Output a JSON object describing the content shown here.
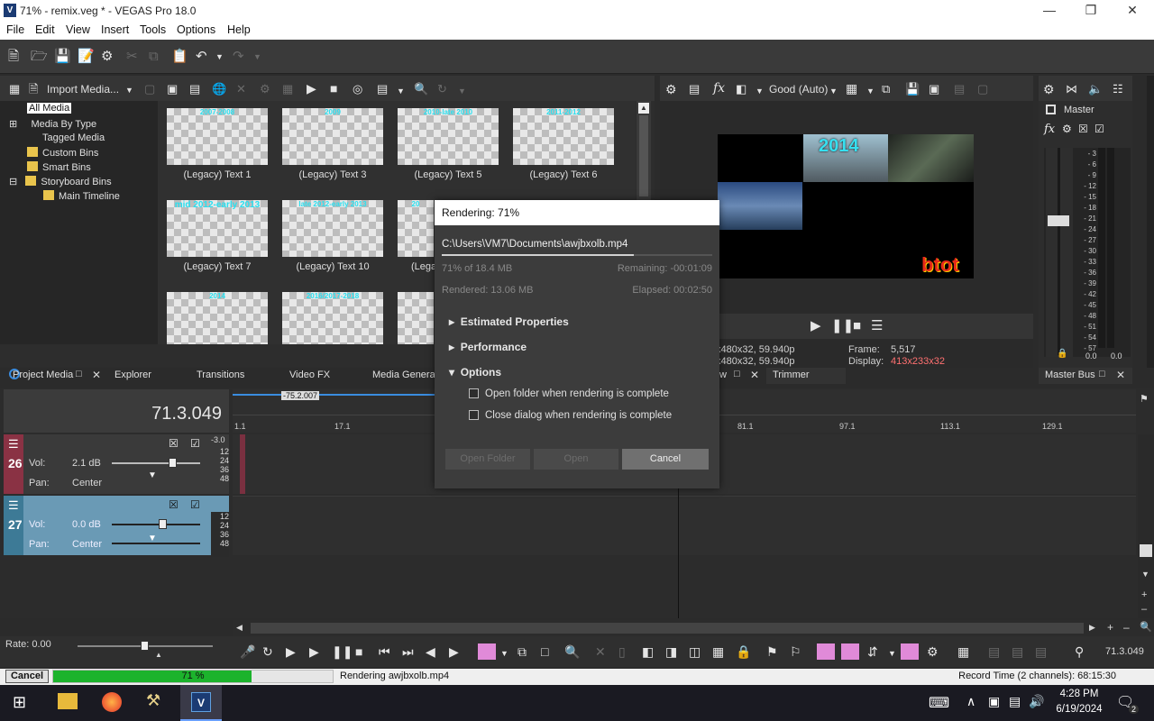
{
  "window": {
    "title": "71% - remix.veg * - VEGAS Pro 18.0",
    "app_icon": "V"
  },
  "menu": [
    "File",
    "Edit",
    "View",
    "Insert",
    "Tools",
    "Options",
    "Help"
  ],
  "media": {
    "import_label": "Import Media...",
    "tree": [
      "All Media",
      "Media By Type",
      "Tagged Media",
      "Custom Bins",
      "Smart Bins",
      "Storyboard Bins",
      "Main Timeline"
    ],
    "thumbs": [
      {
        "label": "(Legacy) Text 1",
        "caption": "2007-2008"
      },
      {
        "label": "(Legacy) Text 3",
        "caption": "2009"
      },
      {
        "label": "(Legacy) Text 5",
        "caption": "2010-late 2010"
      },
      {
        "label": "(Legacy) Text 6",
        "caption": "2011-2012"
      },
      {
        "label": "(Legacy) Text 7",
        "caption": "mid 2012-early 2013"
      },
      {
        "label": "(Legacy) Text 10",
        "caption": "late 2012-early 2013"
      },
      {
        "label": "(Lega",
        "caption": "20"
      },
      {
        "label": "",
        "caption": "2014"
      },
      {
        "label": "",
        "caption": "2016/2017-2018"
      },
      {
        "label": "",
        "caption": ""
      }
    ],
    "tabs": [
      "Project Media",
      "Explorer",
      "Transitions",
      "Video FX",
      "Media Generat"
    ]
  },
  "preview": {
    "quality": "Good (Auto)",
    "overlay_year": "2014",
    "overlay_text": "btot",
    "info_left1": "x480x32, 59.940p",
    "info_left2": "x480x32, 59.940p",
    "frame_label": "Frame:",
    "frame_value": "5,517",
    "display_label": "Display:",
    "display_value": "413x233x32",
    "tab_w": "w",
    "tab_trimmer": "Trimmer"
  },
  "master": {
    "label": "Master",
    "tab": "Master Bus",
    "scale": [
      "3",
      "6",
      "9",
      "12",
      "15",
      "18",
      "21",
      "24",
      "27",
      "30",
      "33",
      "36",
      "39",
      "42",
      "45",
      "48",
      "51",
      "54",
      "57"
    ],
    "left_val": "0.0",
    "right_val": "0.0"
  },
  "dialog": {
    "title": "Rendering: 71%",
    "path": "C:\\Users\\VM7\\Documents\\awjbxolb.mp4",
    "progress_text": "71% of 18.4 MB",
    "remaining": "Remaining: -00:01:09",
    "rendered": "Rendered: 13.06 MB",
    "elapsed": "Elapsed: 00:02:50",
    "sections": [
      "Estimated Properties",
      "Performance",
      "Options"
    ],
    "opt1": "Open folder when rendering is complete",
    "opt2": "Close dialog when rendering is complete",
    "btn_open_folder": "Open Folder",
    "btn_open": "Open",
    "btn_cancel": "Cancel",
    "progress": 0.71
  },
  "timeline": {
    "time": "71.3.049",
    "cursor_label": "-75.2.007",
    "ruler": [
      "1.1",
      "17.1",
      "81.1",
      "97.1",
      "113.1",
      "129.1"
    ],
    "tracks": [
      {
        "num": "26",
        "vol_label": "Vol:",
        "vol": "2.1 dB",
        "pan_label": "Pan:",
        "pan": "Center",
        "db": "-3.0"
      },
      {
        "num": "27",
        "vol_label": "Vol:",
        "vol": "0.0 dB",
        "pan_label": "Pan:",
        "pan": "Center",
        "db": ""
      }
    ],
    "meter": [
      "12",
      "24",
      "36",
      "48"
    ],
    "rate": "Rate: 0.00",
    "end_time": "71.3.049"
  },
  "status": {
    "cancel": "Cancel",
    "percent": "71 %",
    "progress": 0.71,
    "message": "Rendering awjbxolb.mp4",
    "record": "Record Time (2 channels): 68:15:30"
  },
  "taskbar": {
    "time": "4:28 PM",
    "date": "6/19/2024",
    "notif": "2"
  }
}
